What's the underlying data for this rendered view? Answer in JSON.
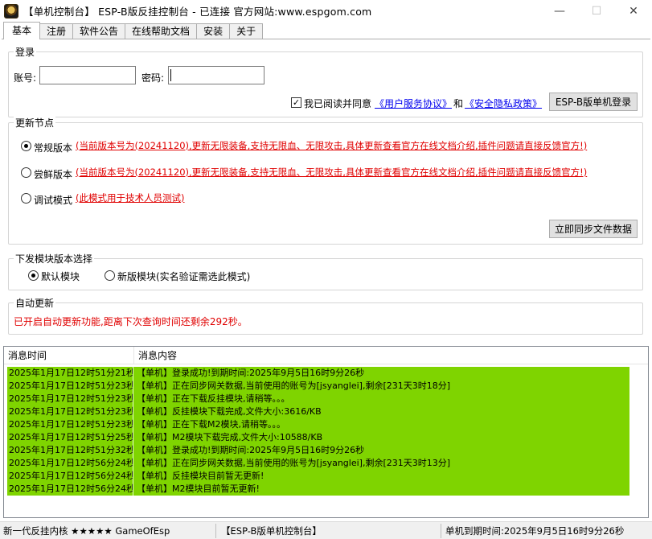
{
  "window": {
    "title": "【单机控制台】 ESP-B版反挂控制台 - 已连接    官方网站:www.espgom.com",
    "minimize_glyph": "—",
    "maximize_glyph": "☐",
    "close_glyph": "✕"
  },
  "tabs": [
    {
      "label": "基本",
      "active": true
    },
    {
      "label": "注册",
      "active": false
    },
    {
      "label": "软件公告",
      "active": false
    },
    {
      "label": "在线帮助文档",
      "active": false
    },
    {
      "label": "安装",
      "active": false
    },
    {
      "label": "关于",
      "active": false
    }
  ],
  "login": {
    "group_title": "登录",
    "account_label": "账号:",
    "account_value": "",
    "password_label": "密码:",
    "password_value": "",
    "agree_checked": true,
    "agree_text": "我已阅读并同意",
    "terms_link": "《用户服务协议》",
    "and_text": "和",
    "privacy_link": "《安全隐私政策》",
    "login_button": "ESP-B版单机登录"
  },
  "update_node": {
    "group_title": "更新节点",
    "options": [
      {
        "label": "常规版本",
        "selected": true,
        "note": "(当前版本号为(20241120),更新无限装备,支持无限血、无限攻击,具体更新查看官方在线文档介绍,插件问题请直接反馈官方!)"
      },
      {
        "label": "尝鲜版本",
        "selected": false,
        "note": "(当前版本号为(20241120),更新无限装备,支持无限血、无限攻击,具体更新查看官方在线文档介绍,插件问题请直接反馈官方!)"
      },
      {
        "label": "调试模式",
        "selected": false,
        "note": "(此模式用于技术人员测试)"
      }
    ],
    "sync_button": "立即同步文件数据"
  },
  "module_select": {
    "group_title": "下发模块版本选择",
    "options": [
      {
        "label": "默认模块",
        "selected": true
      },
      {
        "label": "新版模块(实名验证需选此模式)",
        "selected": false
      }
    ]
  },
  "auto_update": {
    "group_title": "自动更新",
    "text": "已开启自动更新功能,距离下次查询时间还剩余292秒。"
  },
  "log": {
    "col_time": "消息时间",
    "col_content": "消息内容",
    "row_color": "#7fd400",
    "rows": [
      {
        "time": "2025年1月17日12时51分21秒",
        "msg": "【单机】登录成功!到期时间:2025年9月5日16时9分26秒"
      },
      {
        "time": "2025年1月17日12时51分23秒",
        "msg": "【单机】正在同步网关数据,当前使用的账号为[jsyanglei],剩余[231天3时18分]"
      },
      {
        "time": "2025年1月17日12时51分23秒",
        "msg": "【单机】正在下载反挂模块,请稍等。。。"
      },
      {
        "time": "2025年1月17日12时51分23秒",
        "msg": "【单机】反挂模块下载完成,文件大小:3616/KB"
      },
      {
        "time": "2025年1月17日12时51分23秒",
        "msg": "【单机】正在下载M2模块,请稍等。。。"
      },
      {
        "time": "2025年1月17日12时51分25秒",
        "msg": "【单机】M2模块下载完成,文件大小:10588/KB"
      },
      {
        "time": "2025年1月17日12时51分32秒",
        "msg": "【单机】登录成功!到期时间:2025年9月5日16时9分26秒"
      },
      {
        "time": "2025年1月17日12时56分24秒",
        "msg": "【单机】正在同步网关数据,当前使用的账号为[jsyanglei],剩余[231天3时13分]"
      },
      {
        "time": "2025年1月17日12时56分24秒",
        "msg": "【单机】反挂模块目前暂无更新!"
      },
      {
        "time": "2025年1月17日12时56分24秒",
        "msg": "【单机】M2模块目前暂无更新!"
      }
    ]
  },
  "statusbar": {
    "left": "新一代反挂内核 ★★★★★ GameOfEsp",
    "middle": "【ESP-B版单机控制台】",
    "right": "单机到期时间:2025年9月5日16时9分26秒"
  }
}
